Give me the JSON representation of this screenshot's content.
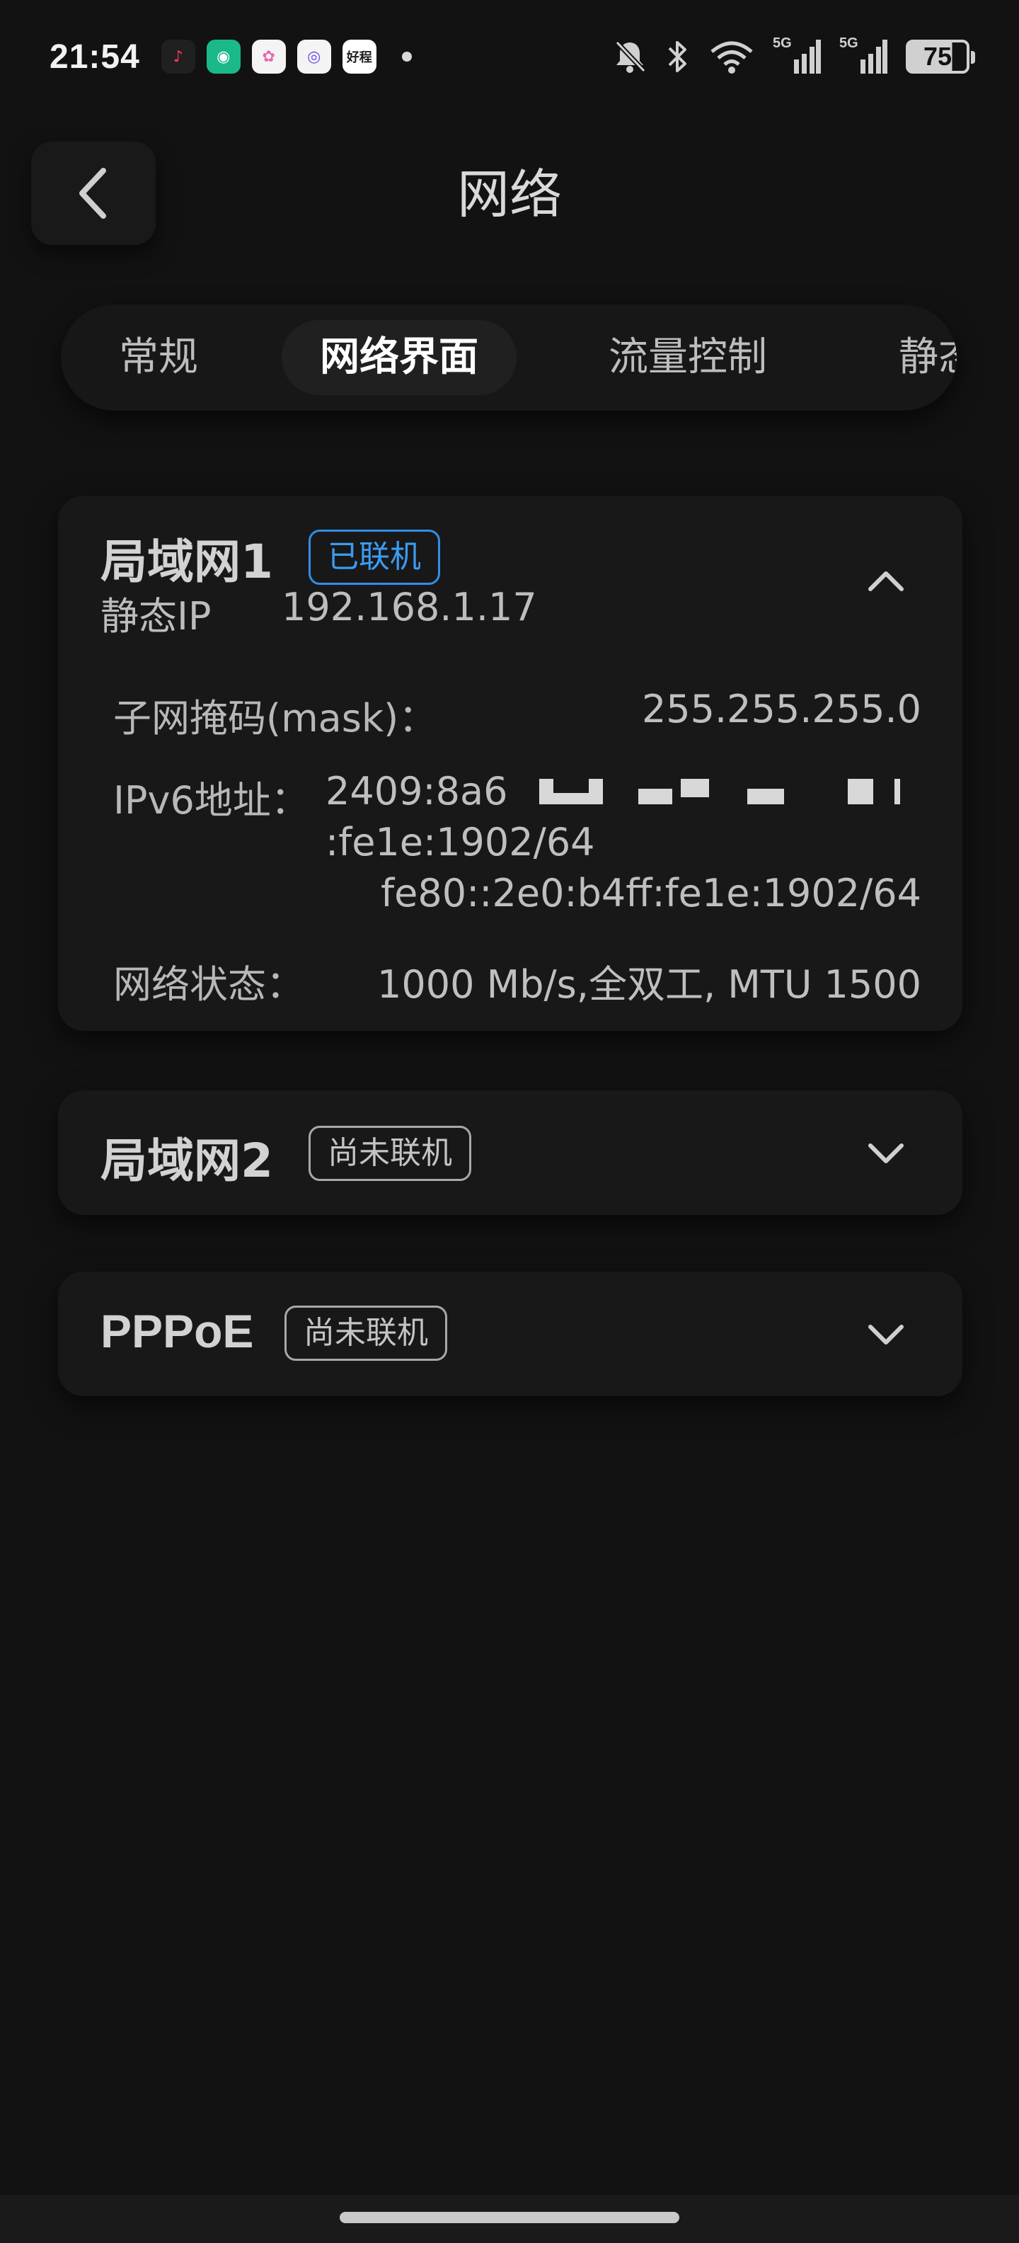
{
  "status_bar": {
    "time": "21:54",
    "apps": [
      {
        "icon": "tiktok-icon",
        "bg": "#202020",
        "glyph": "♪"
      },
      {
        "icon": "mijia-icon",
        "bg": "#1bb98a",
        "glyph": "◉"
      },
      {
        "icon": "colorful-app-icon",
        "bg": "#f4f4f4",
        "glyph": "✿"
      },
      {
        "icon": "fingerprint-app-icon",
        "bg": "#f4f4f4",
        "glyph": "◎"
      },
      {
        "icon": "haocheng-app-icon",
        "bg": "#ffffff",
        "glyph": "好程"
      }
    ],
    "signal_1_label": "5G",
    "signal_2_label": "5G",
    "battery": "75"
  },
  "header": {
    "title": "网络"
  },
  "tabs": [
    {
      "label": "常规",
      "active": false
    },
    {
      "label": "网络界面",
      "active": true
    },
    {
      "label": "流量控制",
      "active": false
    },
    {
      "label": "静态",
      "active": false
    }
  ],
  "lan1": {
    "title": "局域网1",
    "badge": "已联机",
    "mode_label": "静态IP",
    "ip": "192.168.1.17",
    "mask_label": "子网掩码(mask)：",
    "mask_value": "255.255.255.0",
    "ipv6_label": "IPv6地址：",
    "ipv6_line1": "2409:8a6",
    "ipv6_line2": ":fe1e:1902/64",
    "ipv6_line3": "fe80::2e0:b4ff:fe1e:1902/64",
    "status_label": "网络状态：",
    "status_value": "1000 Mb/s,全双工, MTU 1500"
  },
  "lan2": {
    "title": "局域网2",
    "badge": "尚未联机"
  },
  "pppoe": {
    "title": "PPPoE",
    "badge": "尚未联机"
  },
  "colors": {
    "accent_online": "#3a9cf3",
    "background": "#121212",
    "card": "#181818"
  }
}
